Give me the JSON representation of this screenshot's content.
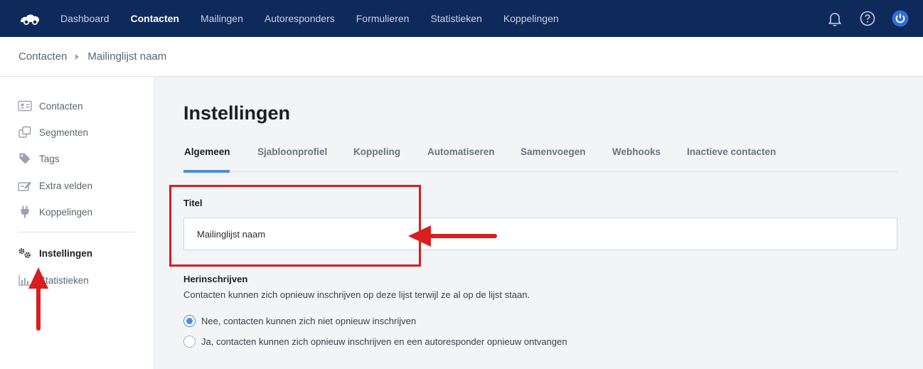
{
  "topnav": {
    "items": [
      {
        "label": "Dashboard"
      },
      {
        "label": "Contacten"
      },
      {
        "label": "Mailingen"
      },
      {
        "label": "Autoresponders"
      },
      {
        "label": "Formulieren"
      },
      {
        "label": "Statistieken"
      },
      {
        "label": "Koppelingen"
      }
    ],
    "active": "Contacten",
    "icons": [
      "logo-icon",
      "bell-icon",
      "help-icon",
      "power-icon"
    ],
    "colors": {
      "background": "#0e2a5a",
      "accent": "#2f6fd6"
    }
  },
  "breadcrumb": {
    "root": "Contacten",
    "current": "Mailinglijst naam"
  },
  "sidebar": {
    "items": [
      {
        "label": "Contacten",
        "icon": "contact-card-icon"
      },
      {
        "label": "Segmenten",
        "icon": "segments-icon"
      },
      {
        "label": "Tags",
        "icon": "tag-icon"
      },
      {
        "label": "Extra velden",
        "icon": "edit-fields-icon"
      },
      {
        "label": "Koppelingen",
        "icon": "plug-icon"
      },
      {
        "label": "Instellingen",
        "icon": "gears-icon"
      },
      {
        "label": "Statistieken",
        "icon": "bar-chart-icon"
      }
    ],
    "active": "Instellingen"
  },
  "main": {
    "title": "Instellingen",
    "tabs": [
      {
        "label": "Algemeen"
      },
      {
        "label": "Sjabloonprofiel"
      },
      {
        "label": "Koppeling"
      },
      {
        "label": "Automatiseren"
      },
      {
        "label": "Samenvoegen"
      },
      {
        "label": "Webhooks"
      },
      {
        "label": "Inactieve contacten"
      }
    ],
    "active_tab": "Algemeen",
    "title_field": {
      "label": "Titel",
      "value": "Mailinglijst naam"
    },
    "resubscribe": {
      "label": "Herinschrijven",
      "description": "Contacten kunnen zich opnieuw inschrijven op deze lijst terwijl ze al op de lijst staan.",
      "options": [
        {
          "label": "Nee, contacten kunnen zich niet opnieuw inschrijven",
          "checked": true
        },
        {
          "label": "Ja, contacten kunnen zich opnieuw inschrijven en een autoresponder opnieuw ontvangen",
          "checked": false
        }
      ]
    }
  },
  "annotations": {
    "color": "#d81e1e"
  }
}
